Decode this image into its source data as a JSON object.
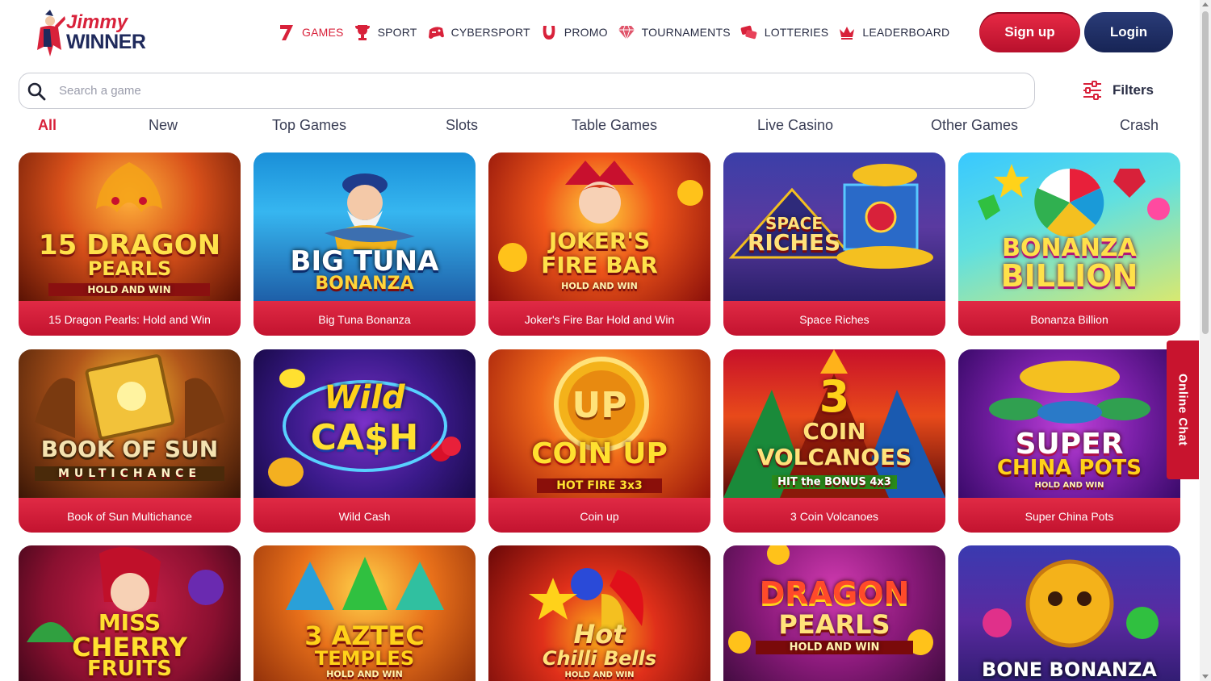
{
  "brand": {
    "line1": "Jimmy",
    "line2": "WINNER"
  },
  "nav": [
    {
      "label": "GAMES",
      "icon": "seven-icon",
      "active": true
    },
    {
      "label": "SPORT",
      "icon": "trophy-icon"
    },
    {
      "label": "CYBERSPORT",
      "icon": "gamepad-icon"
    },
    {
      "label": "PROMO",
      "icon": "horseshoe-icon"
    },
    {
      "label": "TOURNAMENTS",
      "icon": "diamond-icon"
    },
    {
      "label": "LOTTERIES",
      "icon": "tickets-icon"
    },
    {
      "label": "LEADERBOARD",
      "icon": "crown-icon"
    }
  ],
  "auth": {
    "signup": "Sign up",
    "login": "Login"
  },
  "search": {
    "placeholder": "Search a game",
    "value": ""
  },
  "filters": {
    "label": "Filters"
  },
  "tabs": [
    "All",
    "New",
    "Top Games",
    "Slots",
    "Table Games",
    "Live Casino",
    "Other Games",
    "Crash"
  ],
  "games": [
    {
      "name": "15 Dragon Pearls: Hold and Win",
      "art": [
        "15 DRAGON",
        "PEARLS",
        "HOLD AND WIN"
      ]
    },
    {
      "name": "Big Tuna Bonanza",
      "art": [
        "BIG TUNA",
        "BONANZA"
      ]
    },
    {
      "name": "Joker's Fire Bar Hold and Win",
      "art": [
        "JOKER'S",
        "FIRE BAR",
        "HOLD AND WIN"
      ]
    },
    {
      "name": "Space Riches",
      "art": [
        "SPACE",
        "RICHES"
      ]
    },
    {
      "name": "Bonanza Billion",
      "art": [
        "BONANZA",
        "BILLION"
      ]
    },
    {
      "name": "Book of Sun Multichance",
      "art": [
        "BOOK OF SUN",
        "MULTICHANCE"
      ]
    },
    {
      "name": "Wild Cash",
      "art": [
        "Wild",
        "CA$H"
      ]
    },
    {
      "name": "Coin up",
      "art": [
        "UP",
        "COIN UP",
        "HOT FIRE 3x3"
      ]
    },
    {
      "name": "3 Coin Volcanoes",
      "art": [
        "3",
        "COIN",
        "VOLCANOES",
        "HIT the BONUS 4x3"
      ]
    },
    {
      "name": "Super China Pots",
      "art": [
        "SUPER",
        "CHINA POTS",
        "HOLD AND WIN"
      ]
    },
    {
      "art": [
        "MISS",
        "CHERRY",
        "FRUITS"
      ]
    },
    {
      "art": [
        "3 AZTEC",
        "TEMPLES",
        "HOLD AND WIN"
      ]
    },
    {
      "art": [
        "Hot",
        "Chilli Bells",
        "HOLD AND WIN"
      ]
    },
    {
      "art": [
        "DRAGON",
        "PEARLS",
        "HOLD AND WIN"
      ]
    },
    {
      "art": [
        "BONE BONANZA"
      ]
    }
  ],
  "chat": {
    "label": "Online Chat"
  },
  "colors": {
    "accent": "#d8213a",
    "navy": "#1f2a5c",
    "tile_footer": "#d01f3a"
  }
}
